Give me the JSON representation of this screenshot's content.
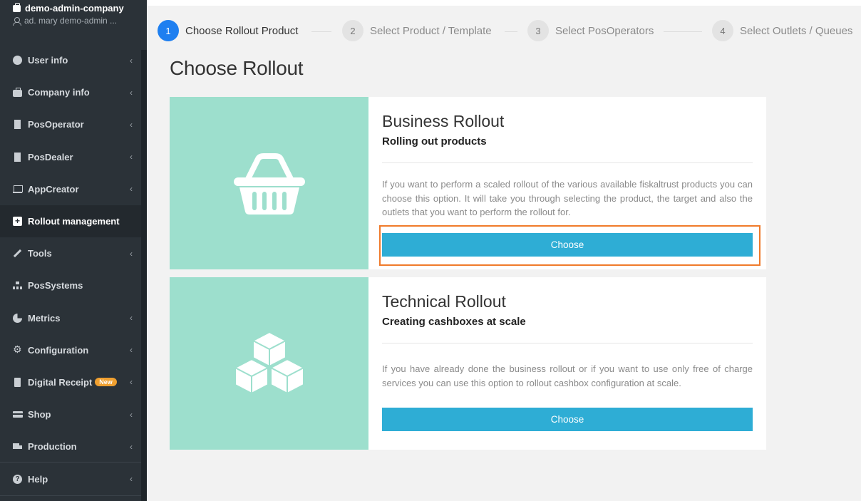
{
  "sidebar": {
    "company_name": "demo-admin-company",
    "user_name": "ad. mary demo-admin ...",
    "items": [
      {
        "label": "User info",
        "icon": "user-circle-icon"
      },
      {
        "label": "Company info",
        "icon": "briefcase-icon"
      },
      {
        "label": "PosOperator",
        "icon": "building-icon"
      },
      {
        "label": "PosDealer",
        "icon": "building-icon"
      },
      {
        "label": "AppCreator",
        "icon": "laptop-icon"
      },
      {
        "label": "Rollout management",
        "icon": "plus-square-icon"
      },
      {
        "label": "Tools",
        "icon": "wrench-icon"
      },
      {
        "label": "PosSystems",
        "icon": "sitemap-icon"
      },
      {
        "label": "Metrics",
        "icon": "pie-chart-icon"
      },
      {
        "label": "Configuration",
        "icon": "cogs-icon"
      },
      {
        "label": "Digital Receipt",
        "icon": "file-icon",
        "badge": "New"
      },
      {
        "label": "Shop",
        "icon": "credit-card-icon"
      },
      {
        "label": "Production",
        "icon": "truck-icon"
      },
      {
        "label": "Help",
        "icon": "question-circle-icon"
      }
    ],
    "chevron": "‹"
  },
  "stepper": {
    "steps": [
      {
        "number": "1",
        "label": "Choose Rollout Product"
      },
      {
        "number": "2",
        "label": "Select Product / Template"
      },
      {
        "number": "3",
        "label": "Select PosOperators"
      },
      {
        "number": "4",
        "label": "Select Outlets / Queues"
      }
    ]
  },
  "page": {
    "title": "Choose Rollout"
  },
  "cards": [
    {
      "title": "Business Rollout",
      "subtitle": "Rolling out products",
      "description": "If you want to perform a scaled rollout of the various available fiskaltrust products you can choose this option. It will take you through selecting the product, the target and also the outlets that you want to perform the rollout for.",
      "button": "Choose",
      "icon": "shopping-basket-icon"
    },
    {
      "title": "Technical Rollout",
      "subtitle": "Creating cashboxes at scale",
      "description": "If you have already done the business rollout or if you want to use only free of charge services you can use this option to rollout cashbox configuration at scale.",
      "button": "Choose",
      "icon": "cubes-icon"
    }
  ],
  "colors": {
    "sidebar_bg": "#2b3238",
    "active_step": "#1e7ff0",
    "card_media": "#9ddfcd",
    "button": "#2eadd5",
    "highlight": "#f07a2a"
  }
}
